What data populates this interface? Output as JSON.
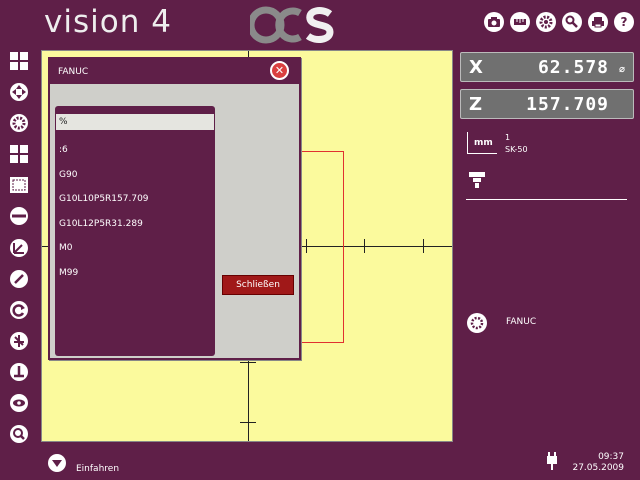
{
  "header": {
    "app_title": "vision 4",
    "logo_text": "OCS",
    "icons": [
      "camera-icon",
      "ruler-icon",
      "gear-icon",
      "wrench-icon",
      "printer-icon",
      "help-icon"
    ]
  },
  "left_toolbar": {
    "icons": [
      "grid-icon",
      "move-icon",
      "spindle-icon",
      "grid-small-icon",
      "frame-icon",
      "minus-icon",
      "angle-icon",
      "gauge-icon",
      "rotate-icon",
      "tool-axis-icon",
      "base-icon",
      "eye-icon",
      "zoom-icon"
    ]
  },
  "dialog": {
    "title": "FANUC",
    "program_lines": [
      "%",
      ":6",
      "G90",
      "G10L10P5R157.709",
      "G10L12P5R31.289",
      "M0",
      "M99"
    ],
    "selected_index": 0,
    "close_button_label": "Schließen"
  },
  "coordinates": {
    "x_label": "X",
    "x_value": "62.578",
    "x_unit": "⌀",
    "z_label": "Z",
    "z_value": "157.709"
  },
  "info_panel": {
    "unit": "mm",
    "tool_number": "1",
    "tool_name": "SK-50",
    "controller_label": "FANUC"
  },
  "footer": {
    "action_label": "Einfahren",
    "time": "09:37",
    "date": "27.05.2009"
  },
  "colors": {
    "background": "#5f1f48",
    "canvas": "#fbfa9d",
    "dialog_bg": "#cfcfca",
    "button_red": "#a01818",
    "contour_red": "#e03030"
  }
}
